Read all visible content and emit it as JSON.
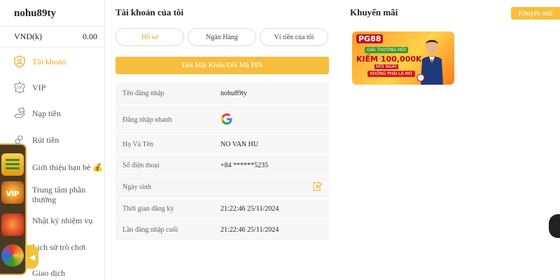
{
  "sidebar": {
    "username": "nohu89ty",
    "balance_label": "VND(k)",
    "balance_value": "0.00",
    "items": [
      {
        "label": "Tài khoản",
        "icon": "user-shield-icon"
      },
      {
        "label": "VIP",
        "icon": "vip-badge-icon"
      },
      {
        "label": "Nạp tiền",
        "icon": "deposit-hand-icon"
      },
      {
        "label": "Rút tiền",
        "icon": "withdraw-icon"
      },
      {
        "label": "Giới thiệu bạn bè 💰",
        "icon": "refer-friend-icon"
      },
      {
        "label": "Trung tâm phần thưởng",
        "icon": "reward-center-icon"
      },
      {
        "label": "Nhật ký nhiệm vụ",
        "icon": "mission-log-icon"
      },
      {
        "label": "Lịch sử trò chơi",
        "icon": "game-history-icon"
      },
      {
        "label": "Giao dịch",
        "icon": "transaction-icon"
      }
    ]
  },
  "account": {
    "title": "Tài khoản của tôi",
    "tabs": [
      "Hồ sơ",
      "Ngân Hàng",
      "Ví tiền của tôi"
    ],
    "pin_button": "Đổi Mật Khẩu/Đổi Mã PIN",
    "rows": [
      {
        "key": "Tên đăng nhập",
        "value": "nohu89ty"
      },
      {
        "key": "Đăng nhập nhanh",
        "value": ""
      },
      {
        "key": "Họ Và Tên",
        "value": "NO VAN HU"
      },
      {
        "key": "Số điện thoại",
        "value": "+84 ******5235"
      },
      {
        "key": "Ngày sinh",
        "value": ""
      },
      {
        "key": "Thời gian đăng ký",
        "value": "21:22:46 25/11/2024"
      },
      {
        "key": "Lần đăng nhập cuối",
        "value": "21:22:46 25/11/2024"
      }
    ]
  },
  "promo": {
    "title": "Khuyến mãi",
    "button": "Khuyến mãi",
    "banner": {
      "logo": "PG88",
      "subtitle": "GIẢI THƯỞNG MỖI",
      "headline": "KIẾM 100,000K",
      "mini": "MỖI NGÀY",
      "ribbon": "KHÔNG PHẢI LÀ MƠ"
    }
  },
  "colors": {
    "accent": "#f7bd3c",
    "active_text": "#f0a824"
  }
}
